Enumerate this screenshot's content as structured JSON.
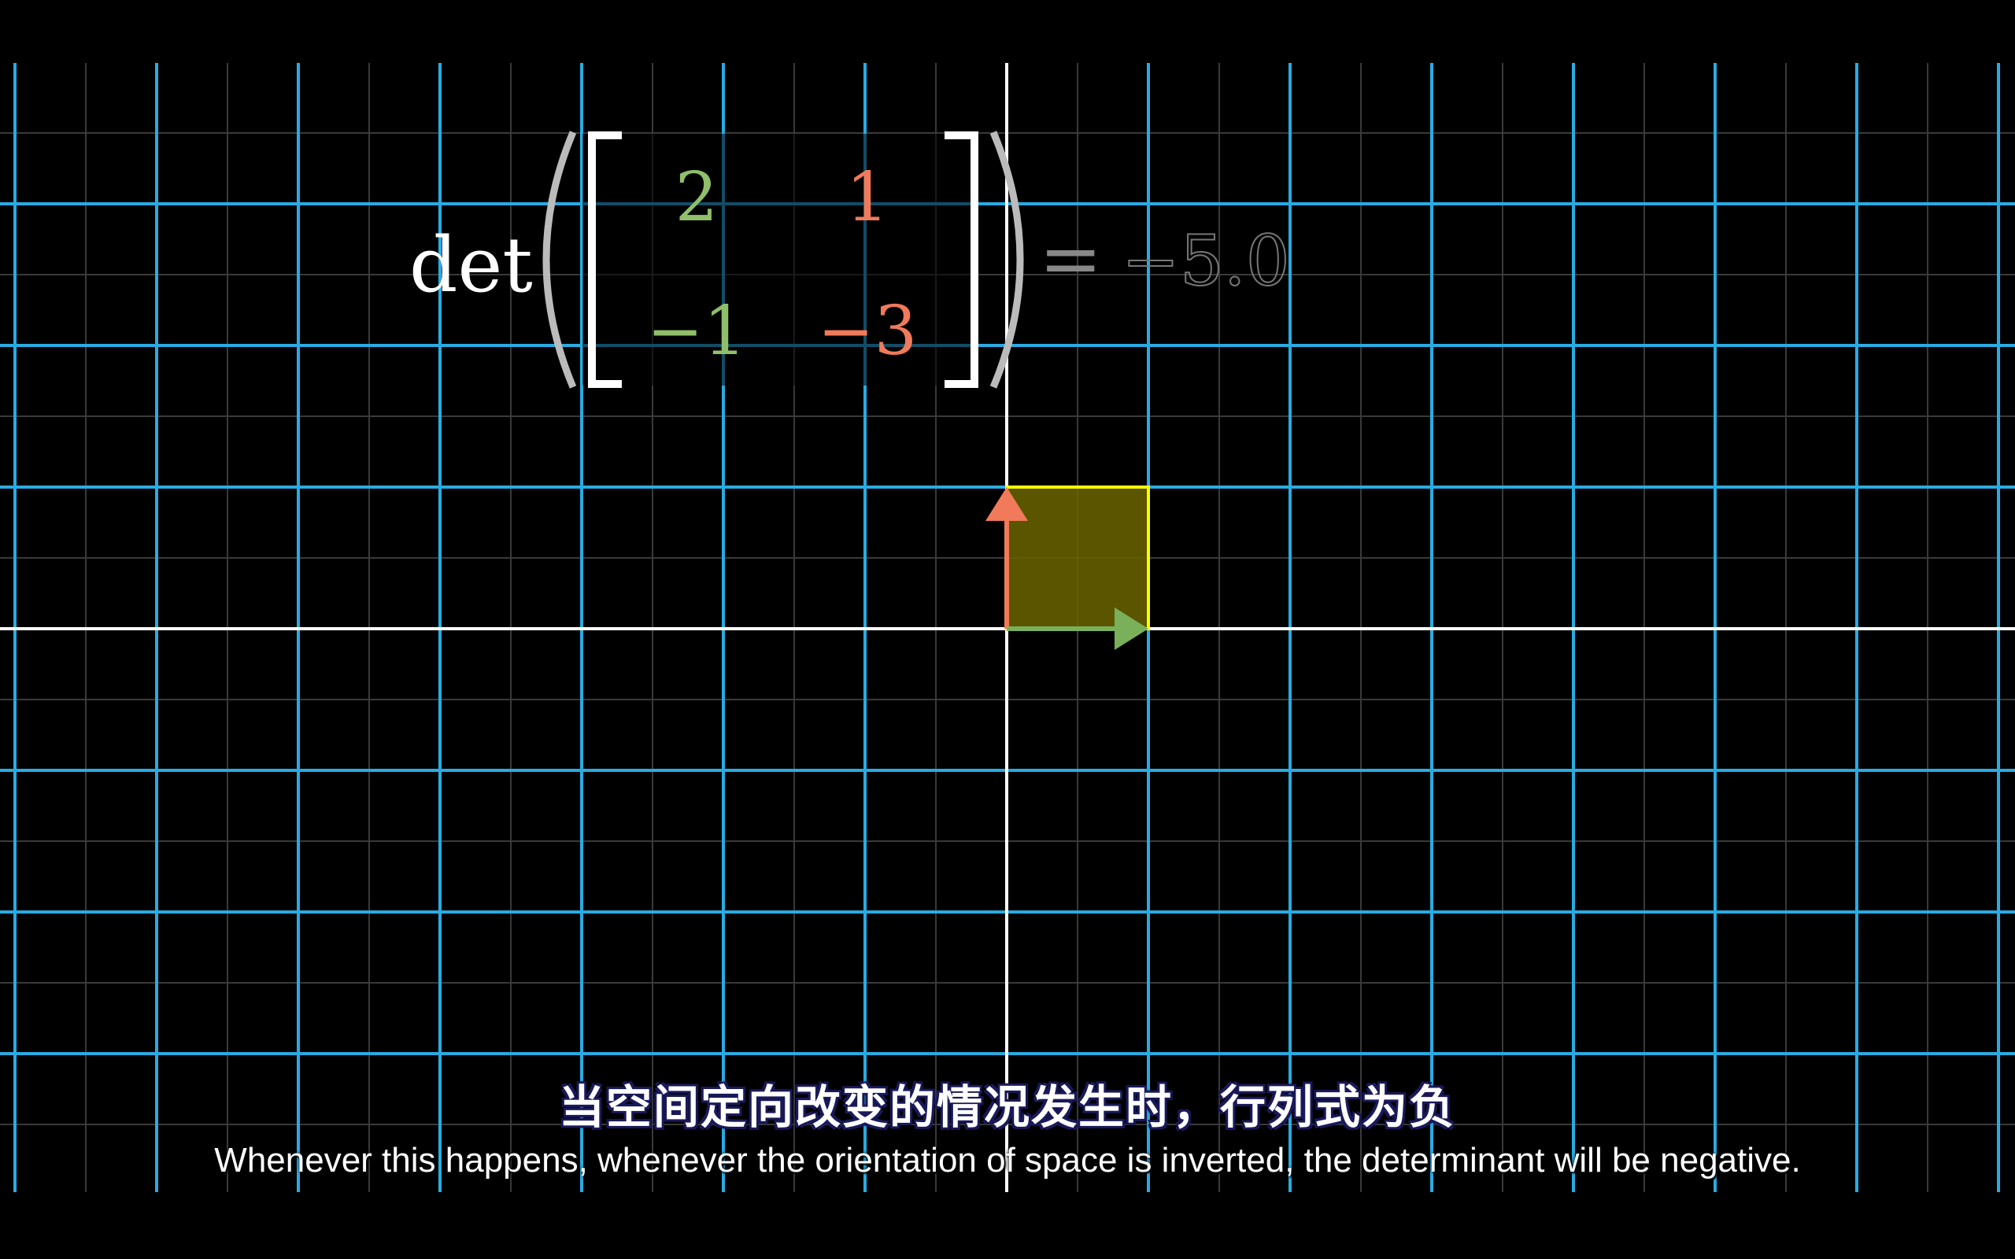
{
  "formula": {
    "det_label": "det",
    "matrix": {
      "a": "2",
      "b": "1",
      "c": "−1",
      "d": "−3"
    },
    "equals": "=",
    "result": "−5.0"
  },
  "vectors": {
    "i_hat": {
      "x": 1,
      "y": 0,
      "color": "#7ab05a"
    },
    "j_hat": {
      "x": 0,
      "y": 1,
      "color": "#f07a5a"
    }
  },
  "area_color": "#ffff00",
  "grid_color": "#29abe2",
  "subtitles": {
    "chinese": "当空间定向改变的情况发生时，行列式为负",
    "english": "Whenever this happens, whenever the orientation of space is inverted, the determinant will be negative."
  }
}
